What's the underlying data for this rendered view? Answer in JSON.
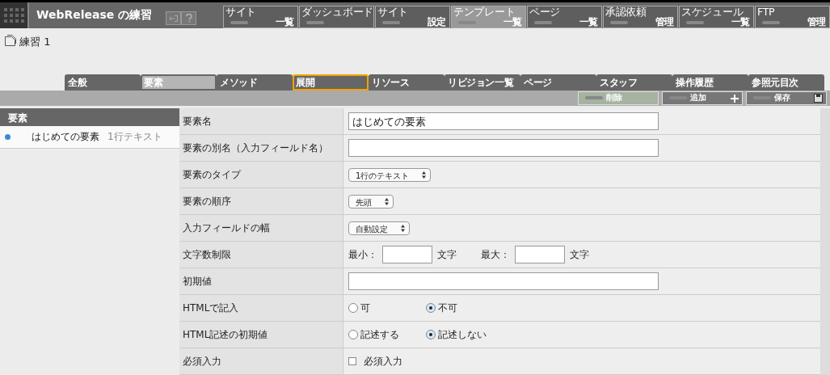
{
  "header": {
    "title": "WebRelease の練習"
  },
  "nav": [
    {
      "top": "サイト",
      "bottom": "一覧",
      "selected": false
    },
    {
      "top": "ダッシュボード",
      "selected": false
    },
    {
      "top": "サイト",
      "bottom": "設定",
      "selected": false
    },
    {
      "top": "テンプレート",
      "bottom": "一覧",
      "selected": true
    },
    {
      "top": "ページ",
      "bottom": "一覧",
      "selected": false
    },
    {
      "top": "承認依頼",
      "bottom": "管理",
      "selected": false
    },
    {
      "top": "スケジュール",
      "bottom": "一覧",
      "selected": false
    },
    {
      "top": "FTP",
      "bottom": "管理",
      "selected": false
    }
  ],
  "page_title": "練習 1",
  "tabs": [
    {
      "label": "全般",
      "selected": false,
      "highlighted": false
    },
    {
      "label": "要素",
      "selected": true,
      "highlighted": false
    },
    {
      "label": "メソッド",
      "selected": false,
      "highlighted": false
    },
    {
      "label": "展開",
      "selected": false,
      "highlighted": true
    },
    {
      "label": "リソース",
      "selected": false,
      "highlighted": false
    },
    {
      "label": "リビジョン一覧",
      "selected": false,
      "highlighted": false
    },
    {
      "label": "ページ",
      "selected": false,
      "highlighted": false
    },
    {
      "label": "スタッフ",
      "selected": false,
      "highlighted": false
    },
    {
      "label": "操作履歴",
      "selected": false,
      "highlighted": false
    },
    {
      "label": "参照元目次",
      "selected": false,
      "highlighted": false
    }
  ],
  "actions": [
    {
      "label": "削除",
      "kind": "delete",
      "selected": true
    },
    {
      "label": "追加",
      "kind": "add",
      "selected": false
    },
    {
      "label": "保存",
      "kind": "save",
      "selected": false
    }
  ],
  "sidebar": {
    "heading": "要素",
    "items": [
      {
        "name": "はじめての要素",
        "type": "1行テキスト",
        "selected": true
      }
    ]
  },
  "form": [
    {
      "label": "要素名",
      "kind": "text",
      "value": "はじめての要素"
    },
    {
      "label": "要素の別名（入力フィールド名）",
      "kind": "text"
    },
    {
      "label": "要素のタイプ",
      "kind": "select",
      "value": "1行のテキスト"
    },
    {
      "label": "要素の順序",
      "kind": "select",
      "value": "先頭"
    },
    {
      "label": "入力フィールドの幅",
      "kind": "select",
      "value": "自動設定"
    },
    {
      "label": "文字数制限",
      "kind": "range",
      "min_label": "最小：",
      "min_unit": "文字",
      "max_label": "最大：",
      "max_unit": "文字"
    },
    {
      "label": "初期値",
      "kind": "text"
    },
    {
      "label": "HTMLで記入",
      "kind": "radio",
      "options": [
        {
          "label": "可",
          "selected": false
        },
        {
          "label": "不可",
          "selected": true
        }
      ]
    },
    {
      "label": "HTML記述の初期値",
      "kind": "radio",
      "options": [
        {
          "label": "記述する",
          "selected": false
        },
        {
          "label": "記述しない",
          "selected": true
        }
      ]
    },
    {
      "label": "必須入力",
      "kind": "checkbox",
      "option": "必須入力",
      "checked": false
    }
  ]
}
